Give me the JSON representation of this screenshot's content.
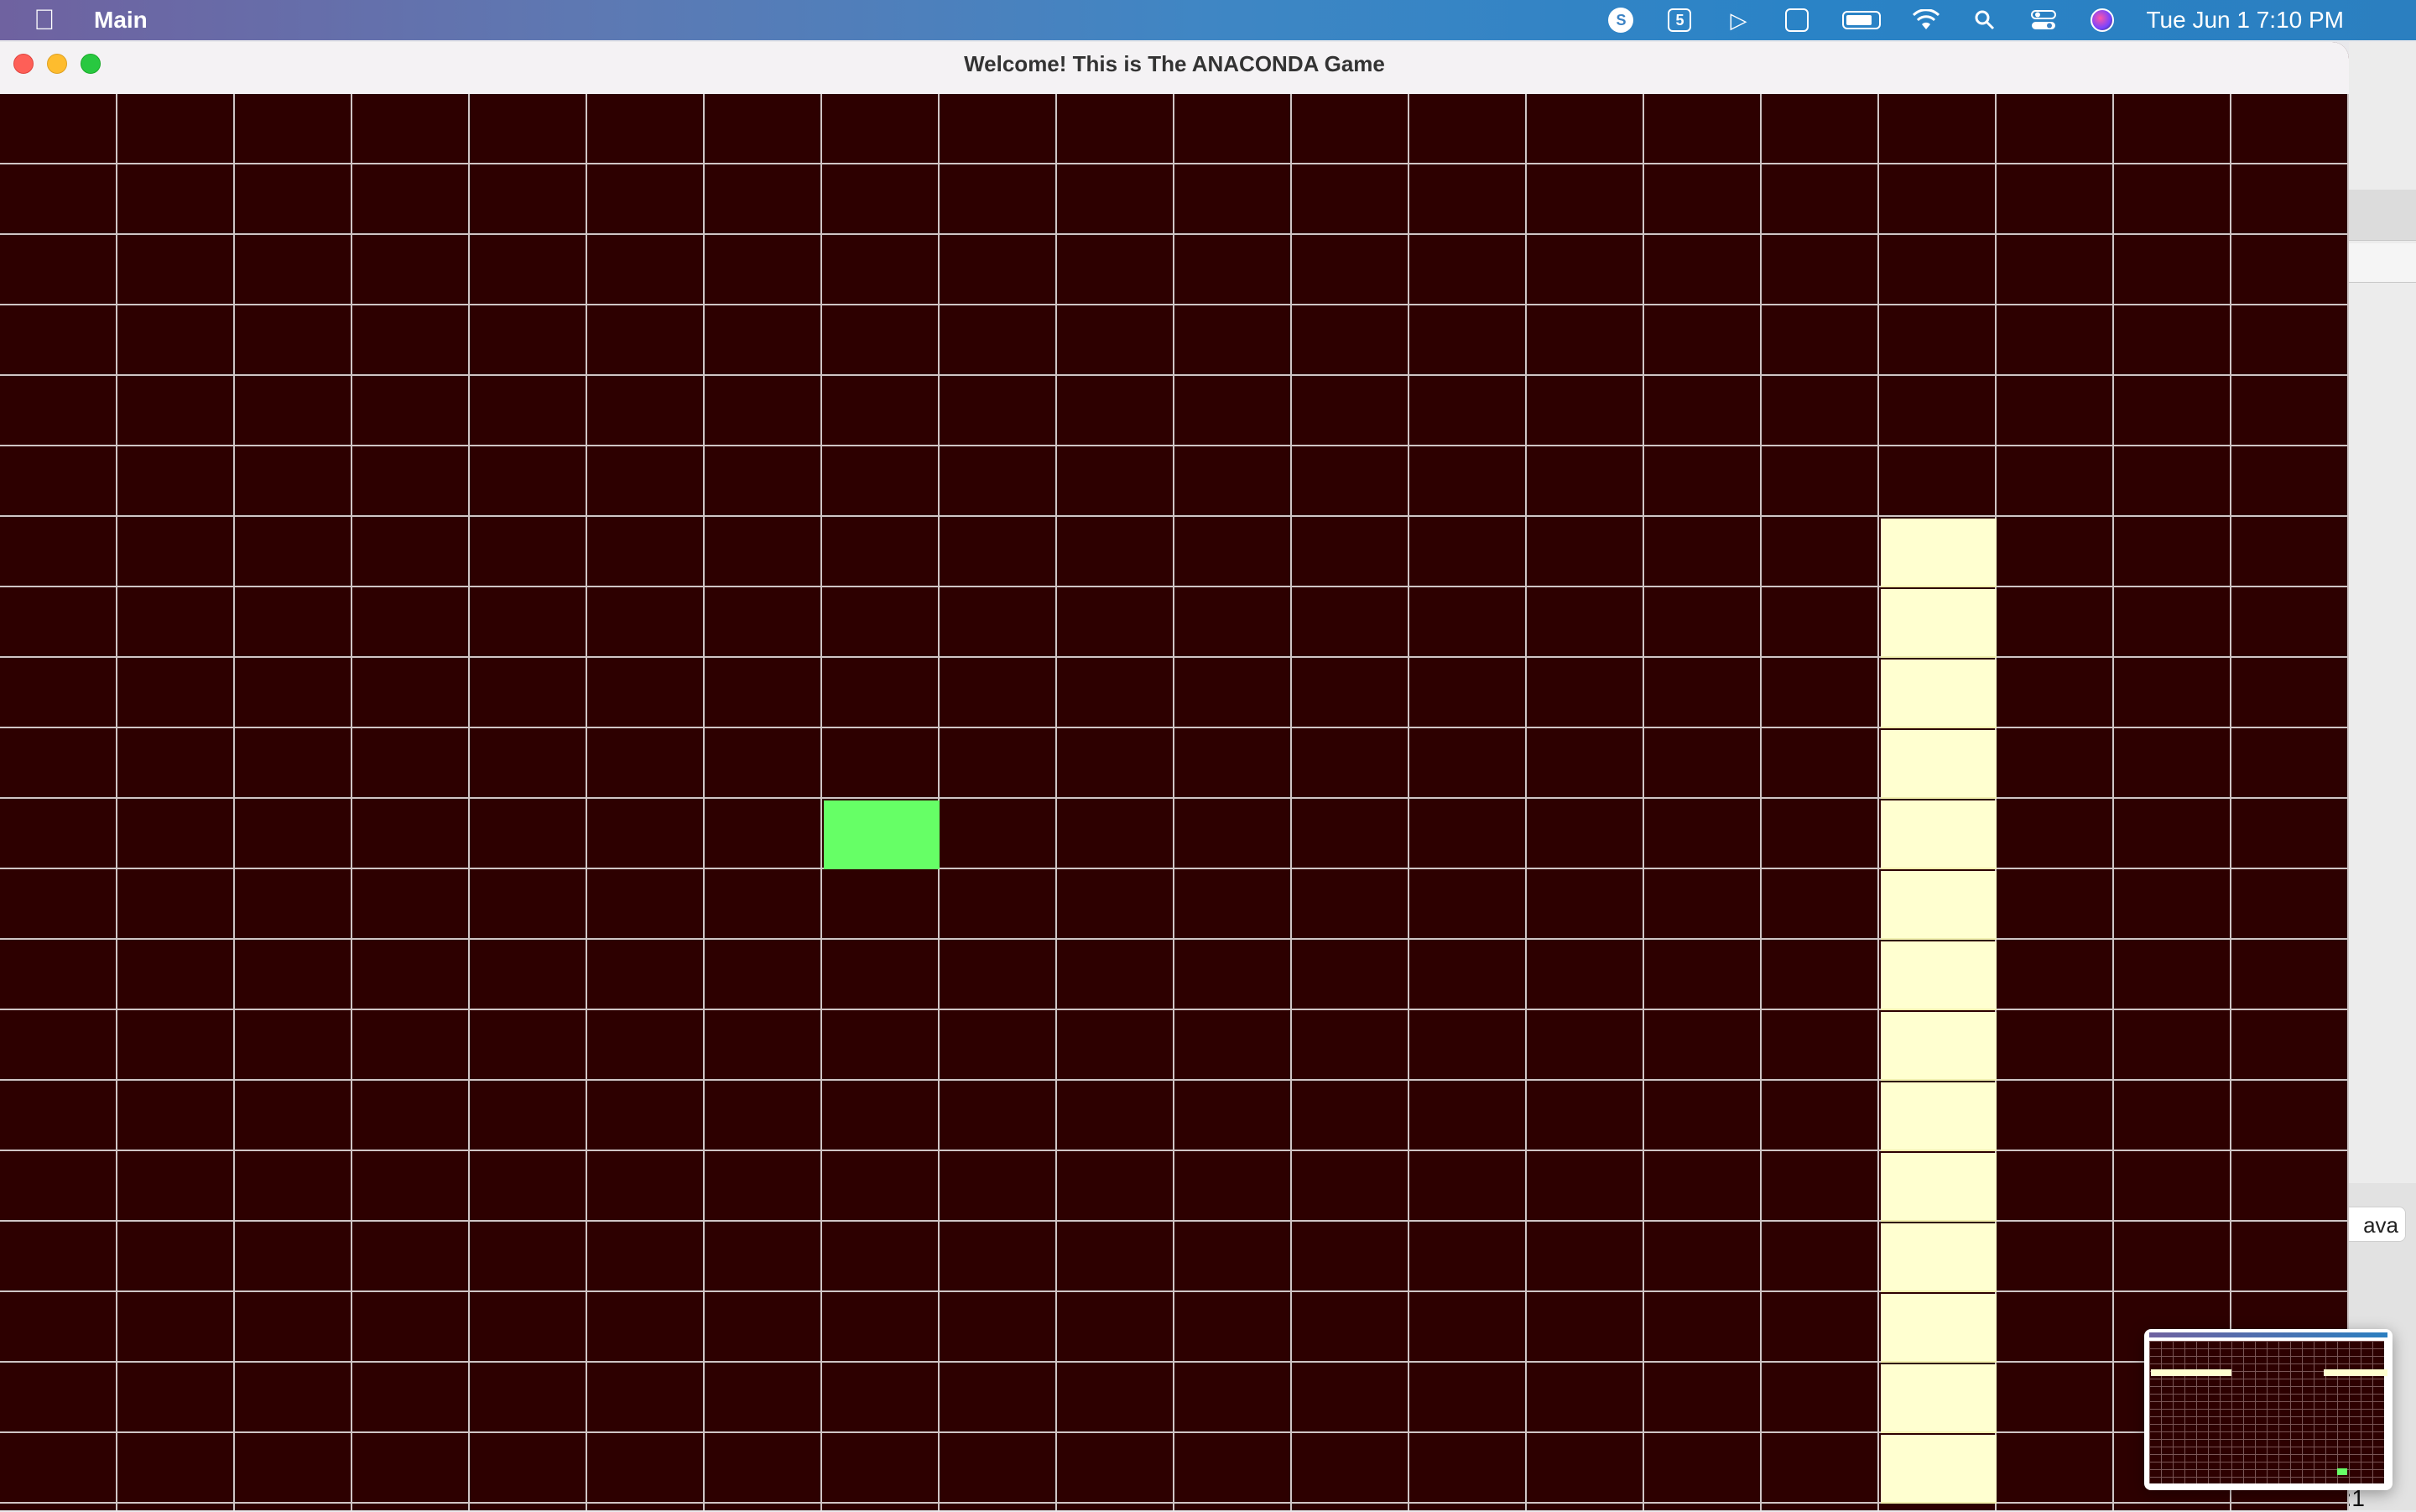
{
  "menubar": {
    "apple_icon": "apple-logo-icon",
    "app_name": "Main",
    "tray": {
      "skype_glyph": "S",
      "s5_glyph": "5",
      "datetime": "Tue Jun 1  7:10 PM"
    }
  },
  "window": {
    "title": "Welcome! This is The ANACONDA Game"
  },
  "game": {
    "grid_columns": 20,
    "grid_rows": 20,
    "colors": {
      "board": "#2d0000",
      "grid_lines": "#cfc5c5",
      "snake": "#ffffd0",
      "food": "#66ff66"
    },
    "snake_cells": [
      {
        "col": 16,
        "row": 6
      },
      {
        "col": 16,
        "row": 7
      },
      {
        "col": 16,
        "row": 8
      },
      {
        "col": 16,
        "row": 9
      },
      {
        "col": 16,
        "row": 10
      },
      {
        "col": 16,
        "row": 11
      },
      {
        "col": 16,
        "row": 12
      },
      {
        "col": 16,
        "row": 13
      },
      {
        "col": 16,
        "row": 14
      },
      {
        "col": 16,
        "row": 15
      },
      {
        "col": 16,
        "row": 16
      },
      {
        "col": 16,
        "row": 17
      },
      {
        "col": 16,
        "row": 18
      },
      {
        "col": 16,
        "row": 19
      }
    ],
    "food_cell": {
      "col": 7,
      "row": 10
    }
  },
  "background_app": {
    "button_label": "ava",
    "status_text": "n:1"
  }
}
